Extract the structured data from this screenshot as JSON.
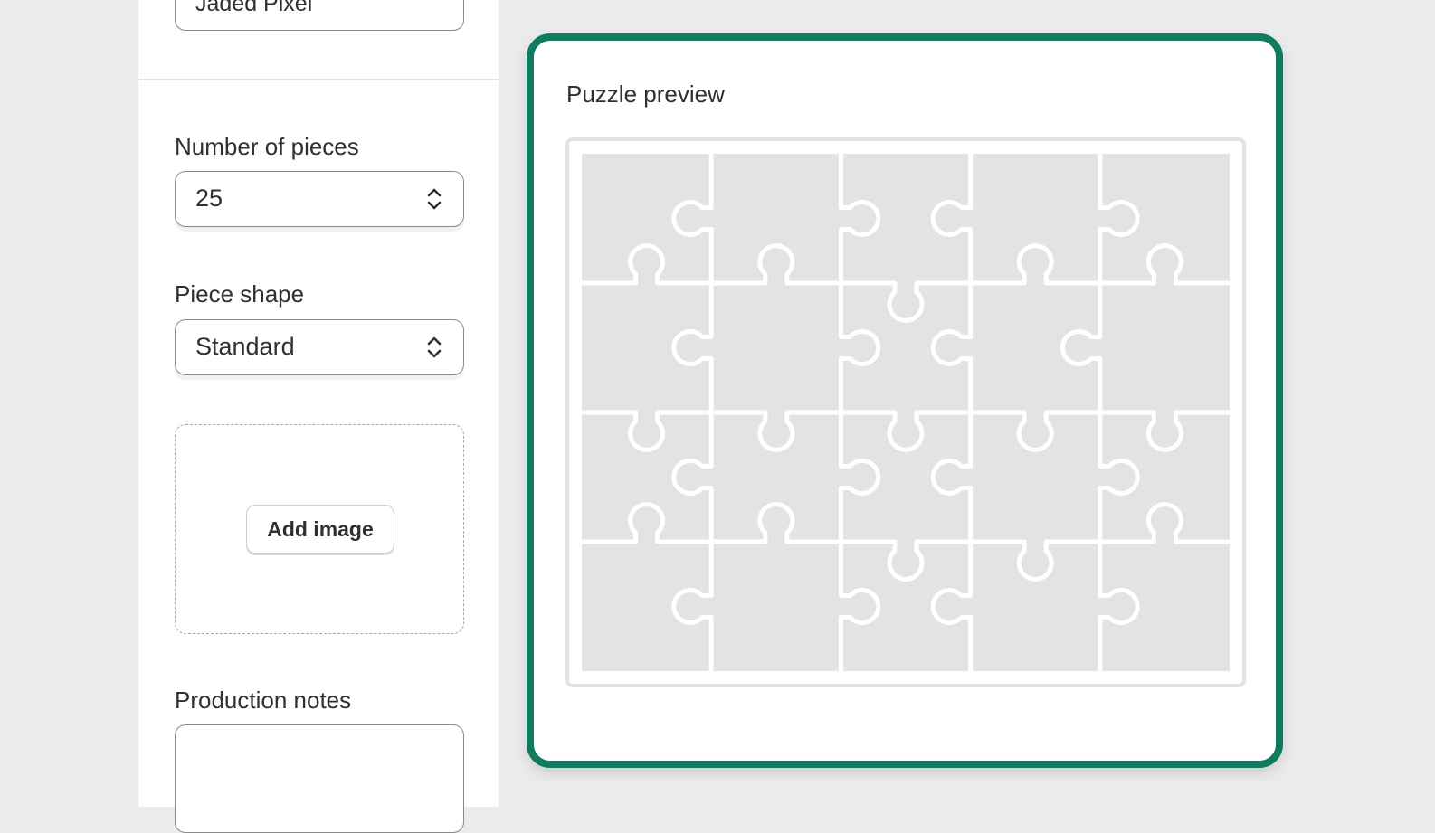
{
  "form": {
    "name_value": "Jaded Pixel",
    "pieces_label": "Number of pieces",
    "pieces_value": "25",
    "shape_label": "Piece shape",
    "shape_value": "Standard",
    "add_image_label": "Add image",
    "notes_label": "Production notes",
    "notes_value": ""
  },
  "preview": {
    "title": "Puzzle preview",
    "columns": 5,
    "rows": 4,
    "accent_color": "#0f7b5f",
    "piece_color": "#e3e3e3"
  }
}
